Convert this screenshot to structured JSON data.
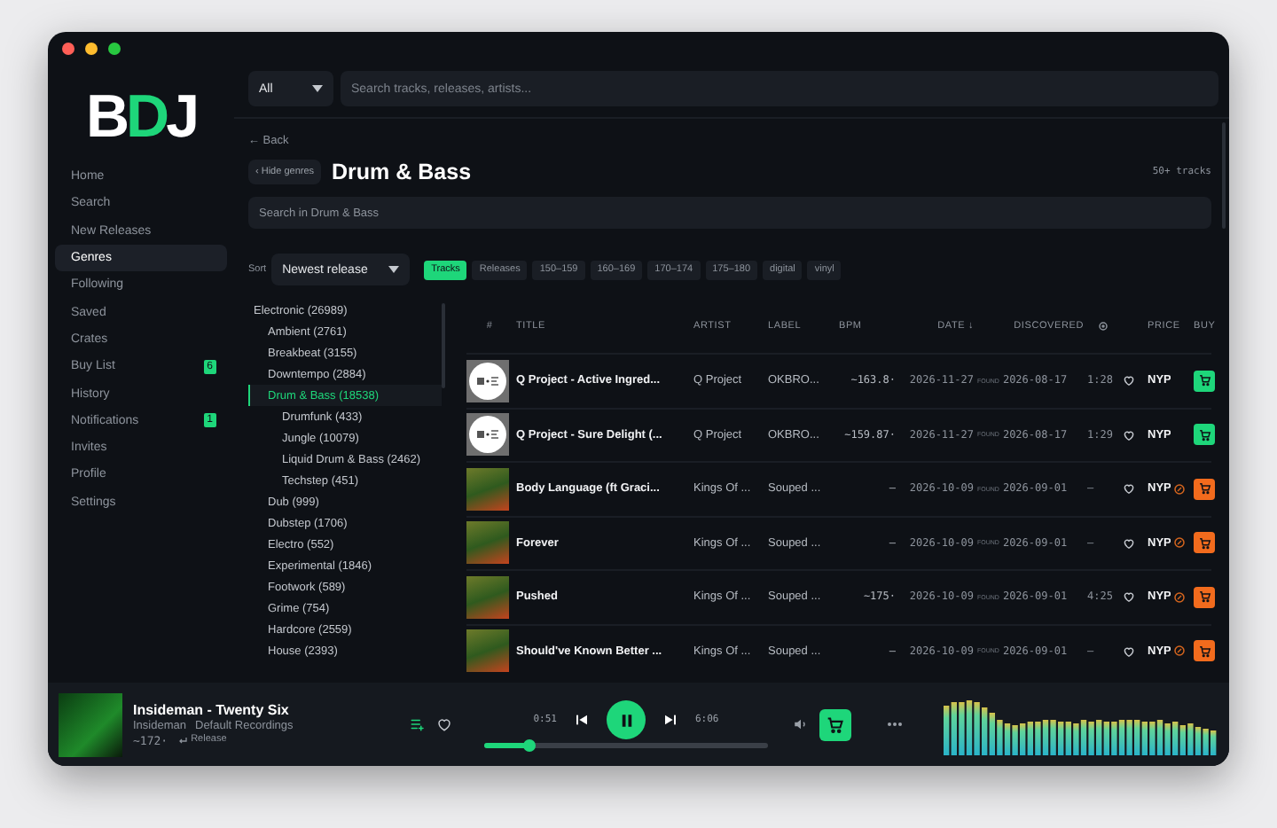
{
  "logo": "BDJ",
  "sidebar": {
    "items": [
      {
        "label": "Home",
        "selected": false
      },
      {
        "label": "Search",
        "selected": false
      },
      {
        "label": "New Releases",
        "selected": false
      },
      {
        "label": "Genres",
        "selected": true
      },
      {
        "label": "Following",
        "selected": false
      },
      {
        "label": "Saved",
        "selected": false
      },
      {
        "label": "Crates",
        "selected": false
      },
      {
        "label": "Buy List",
        "selected": false,
        "badge": "6"
      },
      {
        "label": "History",
        "selected": false
      },
      {
        "label": "Notifications",
        "selected": false,
        "badge": "1"
      },
      {
        "label": "Invites",
        "selected": false
      },
      {
        "label": "Profile",
        "selected": false
      },
      {
        "label": "Settings",
        "selected": false
      }
    ]
  },
  "top_search": {
    "scope": "All",
    "placeholder": "Search tracks, releases, artists..."
  },
  "back": "← Back",
  "hide_genres": "‹ Hide genres",
  "heading": "Drum & Bass",
  "track_count": "50+ tracks",
  "genre_search": {
    "placeholder": "Search in Drum & Bass"
  },
  "sort": {
    "label": "Sort",
    "value": "Newest release"
  },
  "filters": [
    {
      "label": "Tracks",
      "selected": true
    },
    {
      "label": "Releases",
      "selected": false
    },
    {
      "label": "150–159",
      "selected": false
    },
    {
      "label": "160–169",
      "selected": false
    },
    {
      "label": "170–174",
      "selected": false
    },
    {
      "label": "175–180",
      "selected": false
    },
    {
      "label": "digital",
      "selected": false
    },
    {
      "label": "vinyl",
      "selected": false
    }
  ],
  "genre_tree": [
    {
      "label": "Electronic (26989)",
      "selected": false,
      "children": [
        {
          "label": "Ambient (2761)",
          "selected": false
        },
        {
          "label": "Breakbeat (3155)",
          "selected": false
        },
        {
          "label": "Downtempo (2884)",
          "selected": false
        },
        {
          "label": "Drum & Bass (18538)",
          "selected": true,
          "children": [
            {
              "label": "Drumfunk (433)",
              "selected": false
            },
            {
              "label": "Jungle (10079)",
              "selected": false
            },
            {
              "label": "Liquid Drum & Bass (2462)",
              "selected": false
            },
            {
              "label": "Techstep (451)",
              "selected": false
            }
          ]
        },
        {
          "label": "Dub (999)",
          "selected": false
        },
        {
          "label": "Dubstep (1706)",
          "selected": false
        },
        {
          "label": "Electro (552)",
          "selected": false
        },
        {
          "label": "Experimental (1846)",
          "selected": false
        },
        {
          "label": "Footwork (589)",
          "selected": false
        },
        {
          "label": "Grime (754)",
          "selected": false
        },
        {
          "label": "Hardcore (2559)",
          "selected": false
        },
        {
          "label": "House (2393)",
          "selected": false
        }
      ]
    }
  ],
  "table": {
    "columns": [
      "#",
      "TITLE",
      "ARTIST",
      "LABEL",
      "BPM",
      "DATE ↓",
      "DISCOVERED",
      "PRICE",
      "BUY"
    ],
    "rows": [
      {
        "kind": "record",
        "title": "Q Project - Active Ingred...",
        "artist": "Q Project",
        "label": "OKBRO...",
        "bpm": "~163.8·",
        "date": "2026-11-27",
        "found": "FOUND",
        "discovered": "2026-08-17",
        "duration": "1:28",
        "price": "NYP",
        "price_note": false,
        "color": "#1ed67a"
      },
      {
        "kind": "record",
        "title": "Q Project - Sure Delight (...",
        "artist": "Q Project",
        "label": "OKBRO...",
        "bpm": "~159.87·",
        "date": "2026-11-27",
        "found": "FOUND",
        "discovered": "2026-08-17",
        "duration": "1:29",
        "price": "NYP",
        "price_note": false,
        "color": "#1ed67a"
      },
      {
        "kind": "photo",
        "title": "Body Language (ft Graci...",
        "artist": "Kings Of ...",
        "label": "Souped ...",
        "bpm": "–",
        "date": "2026-10-09",
        "found": "FOUND",
        "discovered": "2026-09-01",
        "duration": "–",
        "price": "NYP",
        "price_note": true,
        "color": "#f26b1d"
      },
      {
        "kind": "photo",
        "title": "Forever",
        "artist": "Kings Of ...",
        "label": "Souped ...",
        "bpm": "–",
        "date": "2026-10-09",
        "found": "FOUND",
        "discovered": "2026-09-01",
        "duration": "–",
        "price": "NYP",
        "price_note": true,
        "color": "#f26b1d"
      },
      {
        "kind": "photo",
        "title": "Pushed",
        "artist": "Kings Of ...",
        "label": "Souped ...",
        "bpm": "~175·",
        "date": "2026-10-09",
        "found": "FOUND",
        "discovered": "2026-09-01",
        "duration": "4:25",
        "price": "NYP",
        "price_note": true,
        "color": "#f26b1d"
      },
      {
        "kind": "photo",
        "title": "Should've Known Better ...",
        "artist": "Kings Of ...",
        "label": "Souped ...",
        "bpm": "–",
        "date": "2026-10-09",
        "found": "FOUND",
        "discovered": "2026-09-01",
        "duration": "–",
        "price": "NYP",
        "price_note": true,
        "color": "#f26b1d"
      }
    ]
  },
  "player": {
    "title": "Insideman - Twenty Six",
    "artist": "Insideman",
    "label": "Default Recordings",
    "bpm": "~172·",
    "release": "Release",
    "elapsed": "0:51",
    "total": "6:06",
    "level": 0.16,
    "playing": true
  }
}
